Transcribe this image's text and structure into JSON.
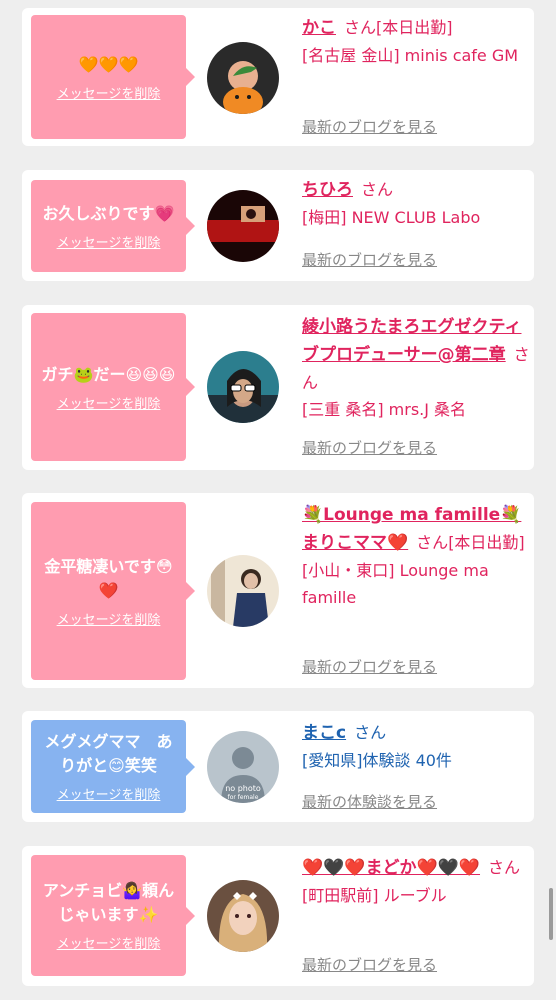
{
  "delete_label": "メッセージを削除",
  "cards": [
    {
      "message": "🧡🧡🧡",
      "name": "かこ",
      "honorific": "さん",
      "extra": "[本日出勤]",
      "shop": "[名古屋 金山] minis cafe GM",
      "link": "最新のブログを見る"
    },
    {
      "message": "お久しぶりです💗",
      "name": "ちひろ",
      "honorific": "さん",
      "shop": "[梅田] NEW CLUB Labo",
      "link": "最新のブログを見る"
    },
    {
      "message": "ガチ🐸だー😆😆😆",
      "name": "綾小路うたまろエグゼクティブプロデューサー@第二章",
      "honorific": "さん",
      "shop": "[三重 桑名] mrs.J 桑名",
      "link": "最新のブログを見る"
    },
    {
      "message": "金平糖凄いです😳❤️",
      "name": "💐Lounge ma famille💐まりこママ❤️",
      "honorific": "さん",
      "extra": "[本日出勤]",
      "shop": "[小山・東口] Lounge ma famille",
      "link": "最新のブログを見る"
    },
    {
      "message": "メグメグママ　ありがと😊笑笑",
      "name": "まこc",
      "honorific": "さん",
      "shop": "[愛知県]体験談 40件",
      "link": "最新の体験談を見る",
      "avatar_text_1": "no photo",
      "avatar_text_2": "for female"
    },
    {
      "message": "アンチョビ🤷‍♀️頼んじゃいます✨",
      "name": "❤️🖤❤️まどか❤️🖤❤️",
      "honorific": "さん",
      "shop": "[町田駅前] ルーブル",
      "link": "最新のブログを見る"
    }
  ],
  "colors": {
    "background": "#eeeeee",
    "pink_bubble": "#ff9cb0",
    "blue_bubble": "#87b3f0",
    "pink_text": "#e0245e",
    "blue_text": "#1f63b0",
    "link_gray": "#888888"
  }
}
